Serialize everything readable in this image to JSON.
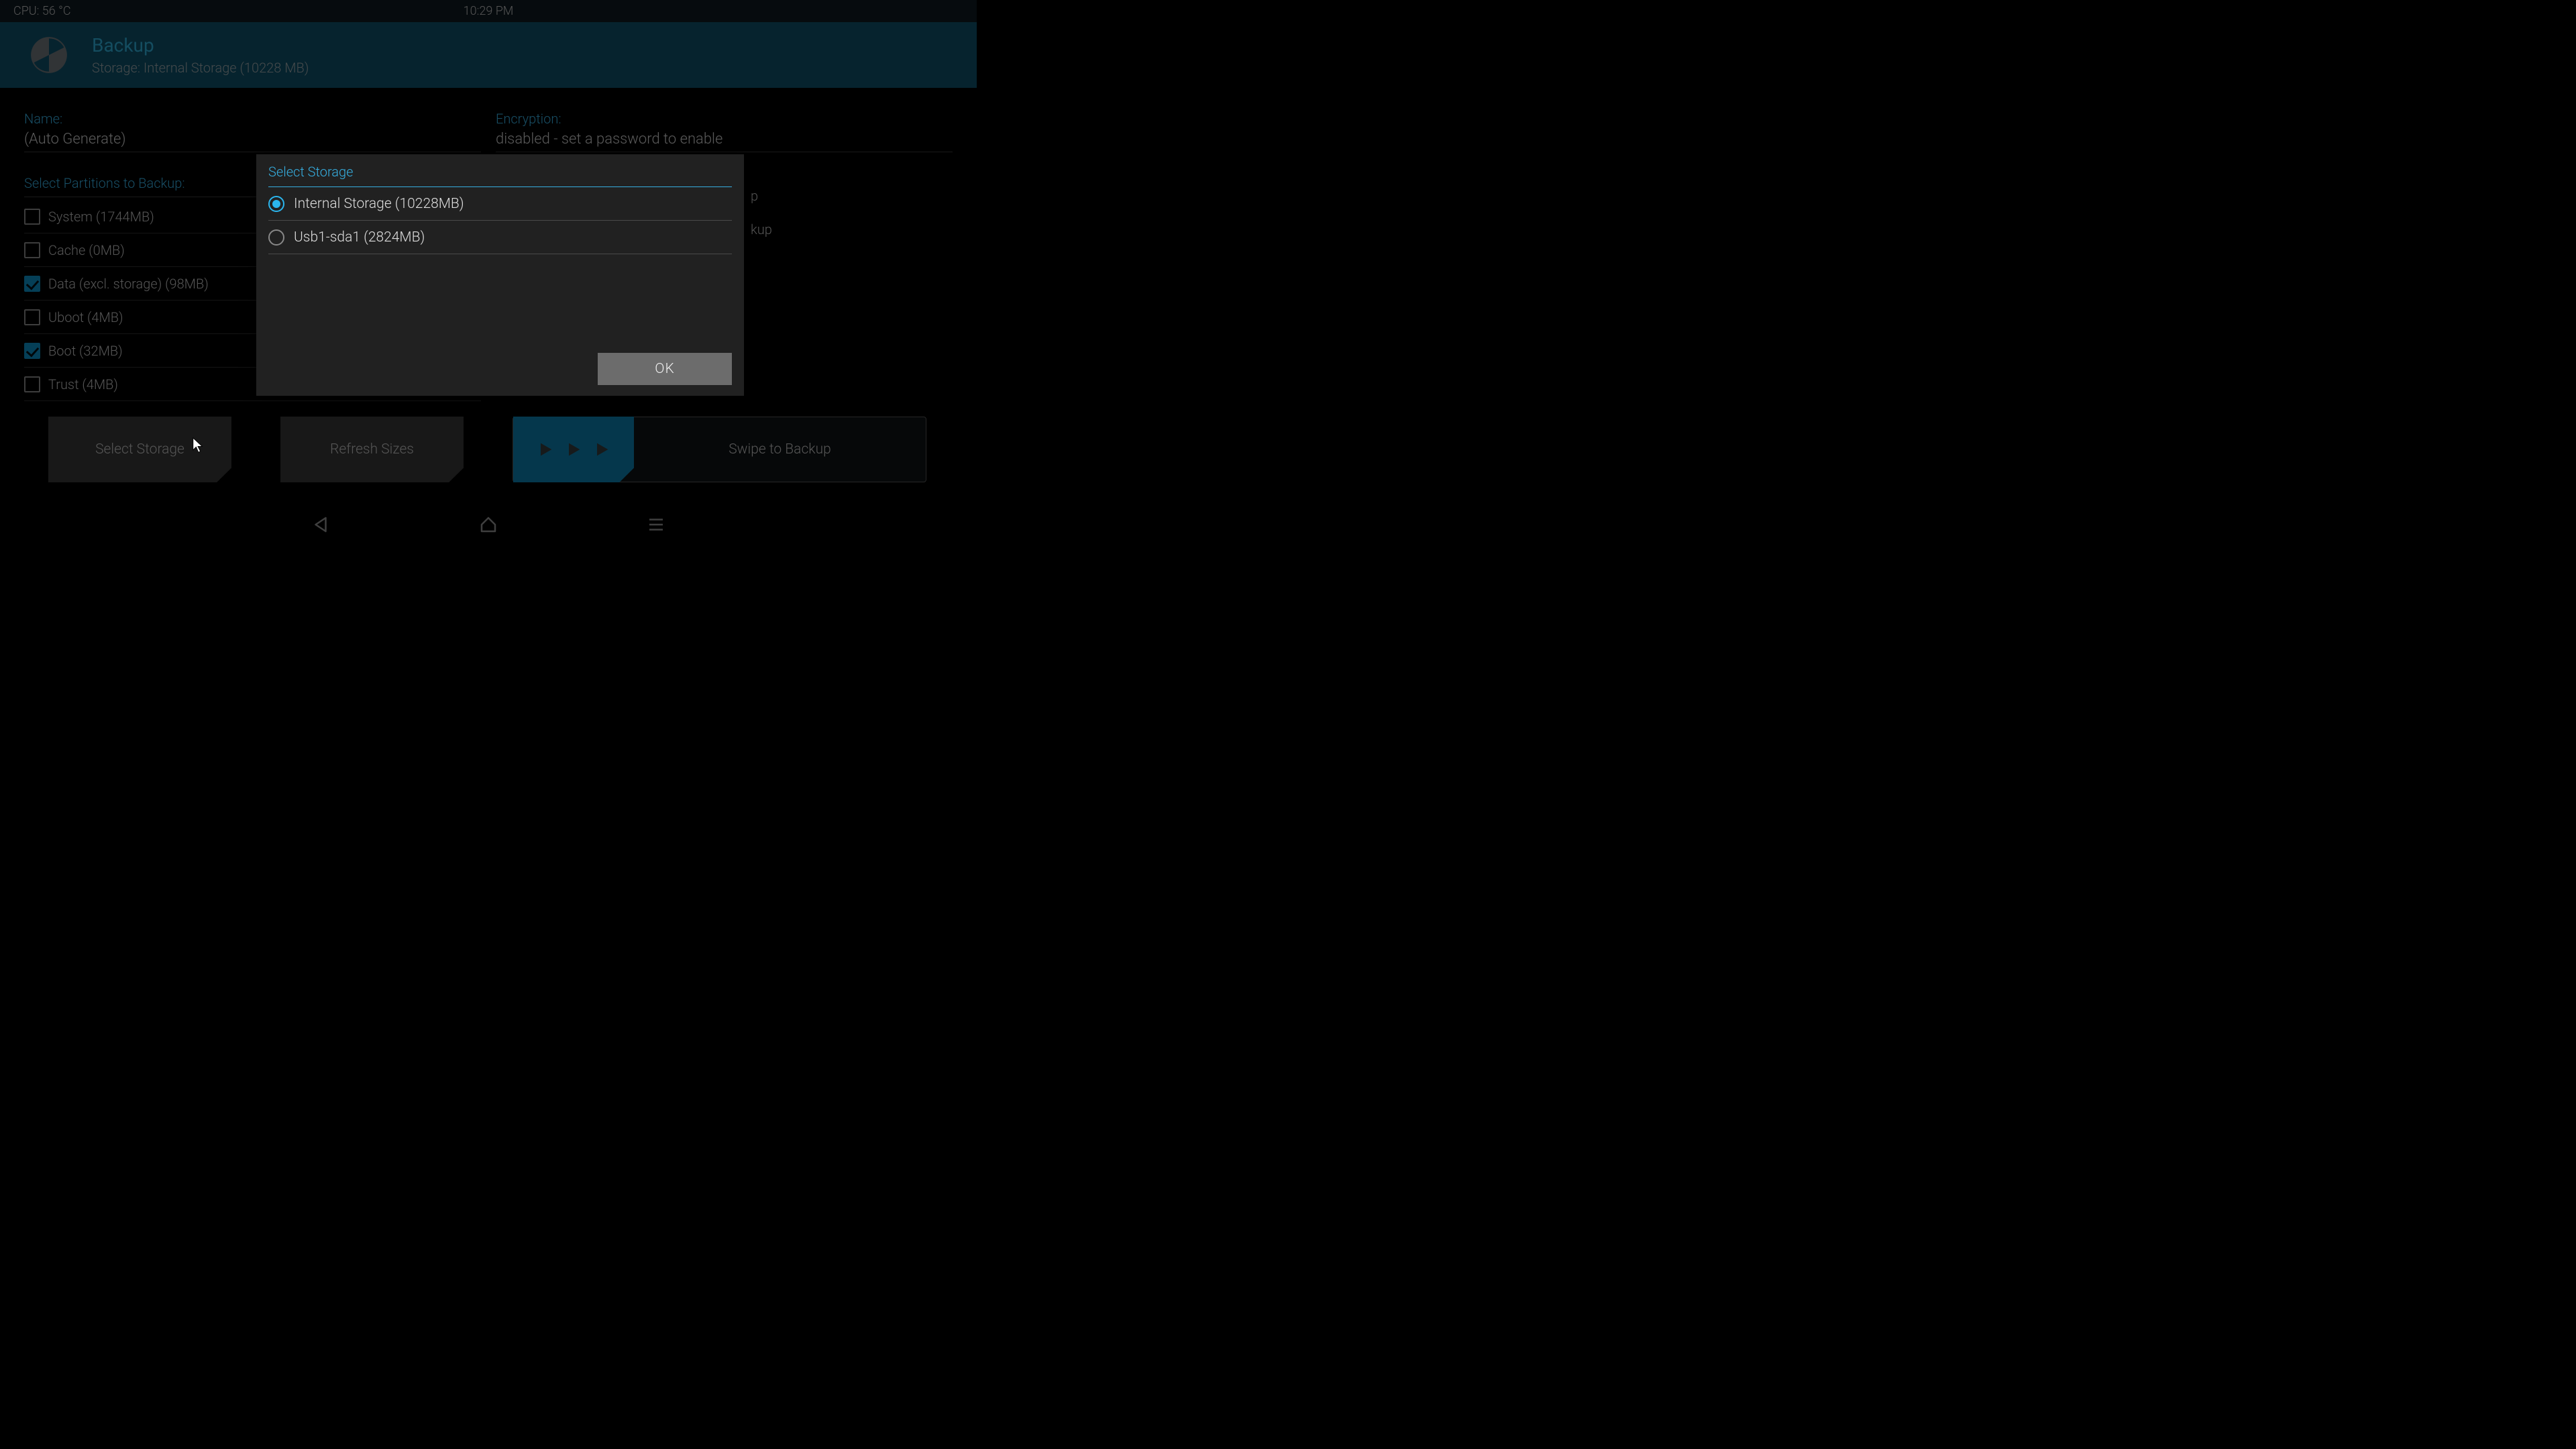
{
  "statusbar": {
    "cpu": "CPU: 56 °C",
    "time": "10:29 PM"
  },
  "header": {
    "title": "Backup",
    "subtitle": "Storage: Internal Storage (10228 MB)"
  },
  "name": {
    "label": "Name:",
    "value": "(Auto Generate)"
  },
  "encryption": {
    "label": "Encryption:",
    "value": "disabled - set a password to enable"
  },
  "partition_header": "Select Partitions to Backup:",
  "partitions": [
    {
      "label": "System (1744MB)",
      "checked": false
    },
    {
      "label": "Cache (0MB)",
      "checked": false
    },
    {
      "label": "Data (excl. storage) (98MB)",
      "checked": true
    },
    {
      "label": "Uboot (4MB)",
      "checked": false
    },
    {
      "label": "Boot (32MB)",
      "checked": true
    },
    {
      "label": "Trust (4MB)",
      "checked": false
    }
  ],
  "right_opts": [
    "p",
    "kup"
  ],
  "buttons": {
    "select_storage": "Select Storage",
    "refresh_sizes": "Refresh Sizes",
    "swipe": "Swipe to Backup"
  },
  "dialog": {
    "title": "Select Storage",
    "options": [
      {
        "label": "Internal Storage (10228MB)",
        "selected": true
      },
      {
        "label": "Usb1-sda1 (2824MB)",
        "selected": false
      }
    ],
    "ok": "OK"
  }
}
